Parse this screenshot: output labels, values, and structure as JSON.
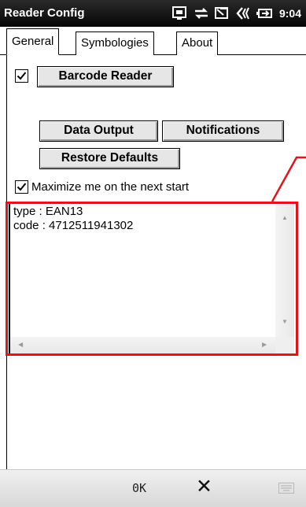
{
  "window": {
    "title": "Reader Config",
    "time": "9:04",
    "status_icons": [
      "screen-icon",
      "sync-icon",
      "message-icon",
      "volume-icon",
      "battery-icon"
    ]
  },
  "tabs": [
    {
      "label": "General",
      "active": true
    },
    {
      "label": "Symbologies",
      "active": false
    },
    {
      "label": "About",
      "active": false
    }
  ],
  "general": {
    "barcode_reader": {
      "label": "Barcode Reader",
      "checked": true
    },
    "data_output_label": "Data Output",
    "notifications_label": "Notifications",
    "restore_defaults_label": "Restore Defaults",
    "maximize": {
      "label": "Maximize me on the next start",
      "checked": true
    }
  },
  "output": {
    "lines": [
      "type : EAN13",
      "code : 4712511941302"
    ]
  },
  "bottom_bar": {
    "ok_label": "0K",
    "close_glyph": "✕"
  },
  "colors": {
    "title_bar": "#050505",
    "highlight": "#e0141a",
    "button_face": "#e6e6e6"
  }
}
